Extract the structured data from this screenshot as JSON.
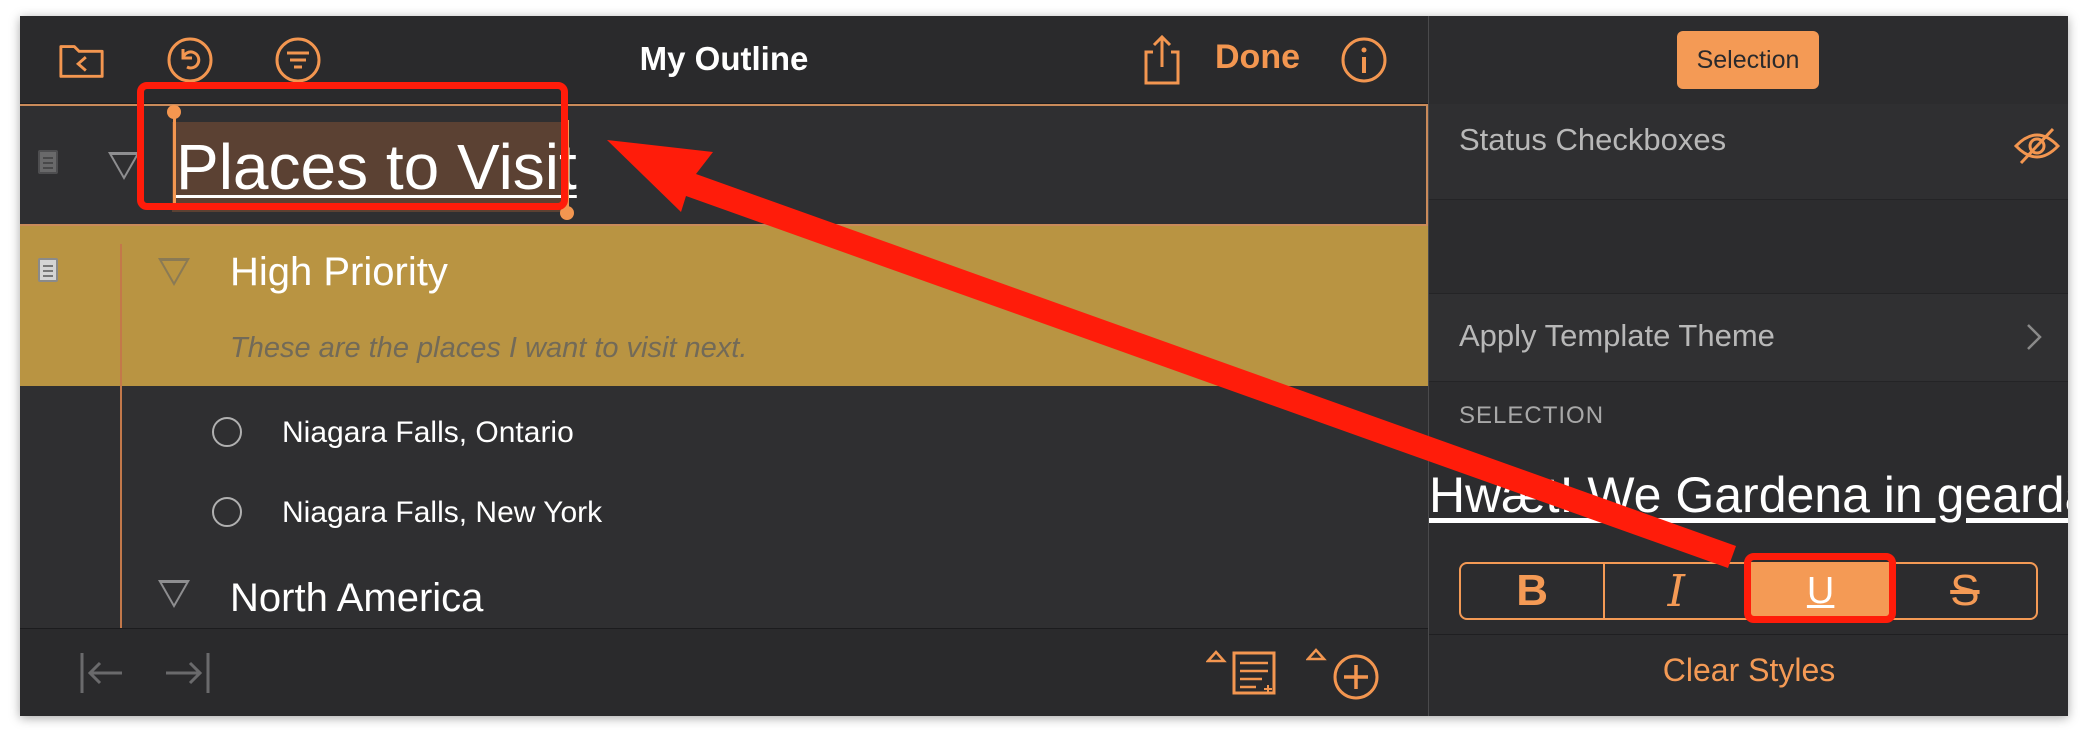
{
  "toolbar": {
    "title": "My Outline",
    "done_label": "Done"
  },
  "outline": {
    "root_title": "Places to Visit",
    "rows": [
      {
        "label": "High Priority",
        "note": "These are the places I want to visit next."
      },
      {
        "label": "Niagara Falls, Ontario"
      },
      {
        "label": "Niagara Falls, New York"
      },
      {
        "label": "North America"
      }
    ]
  },
  "inspector": {
    "selection_button": "Selection",
    "status_checkboxes": "Status Checkboxes",
    "apply_template_theme": "Apply Template Theme",
    "section_header": "SELECTION",
    "sample_text": "Hwæt! We Gardena in geardagum",
    "styles": [
      {
        "label": "B",
        "active": false
      },
      {
        "label": "I",
        "active": false
      },
      {
        "label": "U",
        "active": true
      },
      {
        "label": "S",
        "active": false
      }
    ],
    "clear_styles": "Clear Styles"
  },
  "colors": {
    "accent": "#f49a55",
    "highlight_row": "#b99442",
    "annotation_red": "#ff1c0a"
  },
  "icons": [
    "folder-back-icon",
    "undo-icon",
    "filter-icon",
    "share-icon",
    "info-icon",
    "eye-hidden-icon",
    "chevron-right-icon",
    "outdent-icon",
    "indent-icon",
    "add-note-icon",
    "add-row-icon"
  ]
}
